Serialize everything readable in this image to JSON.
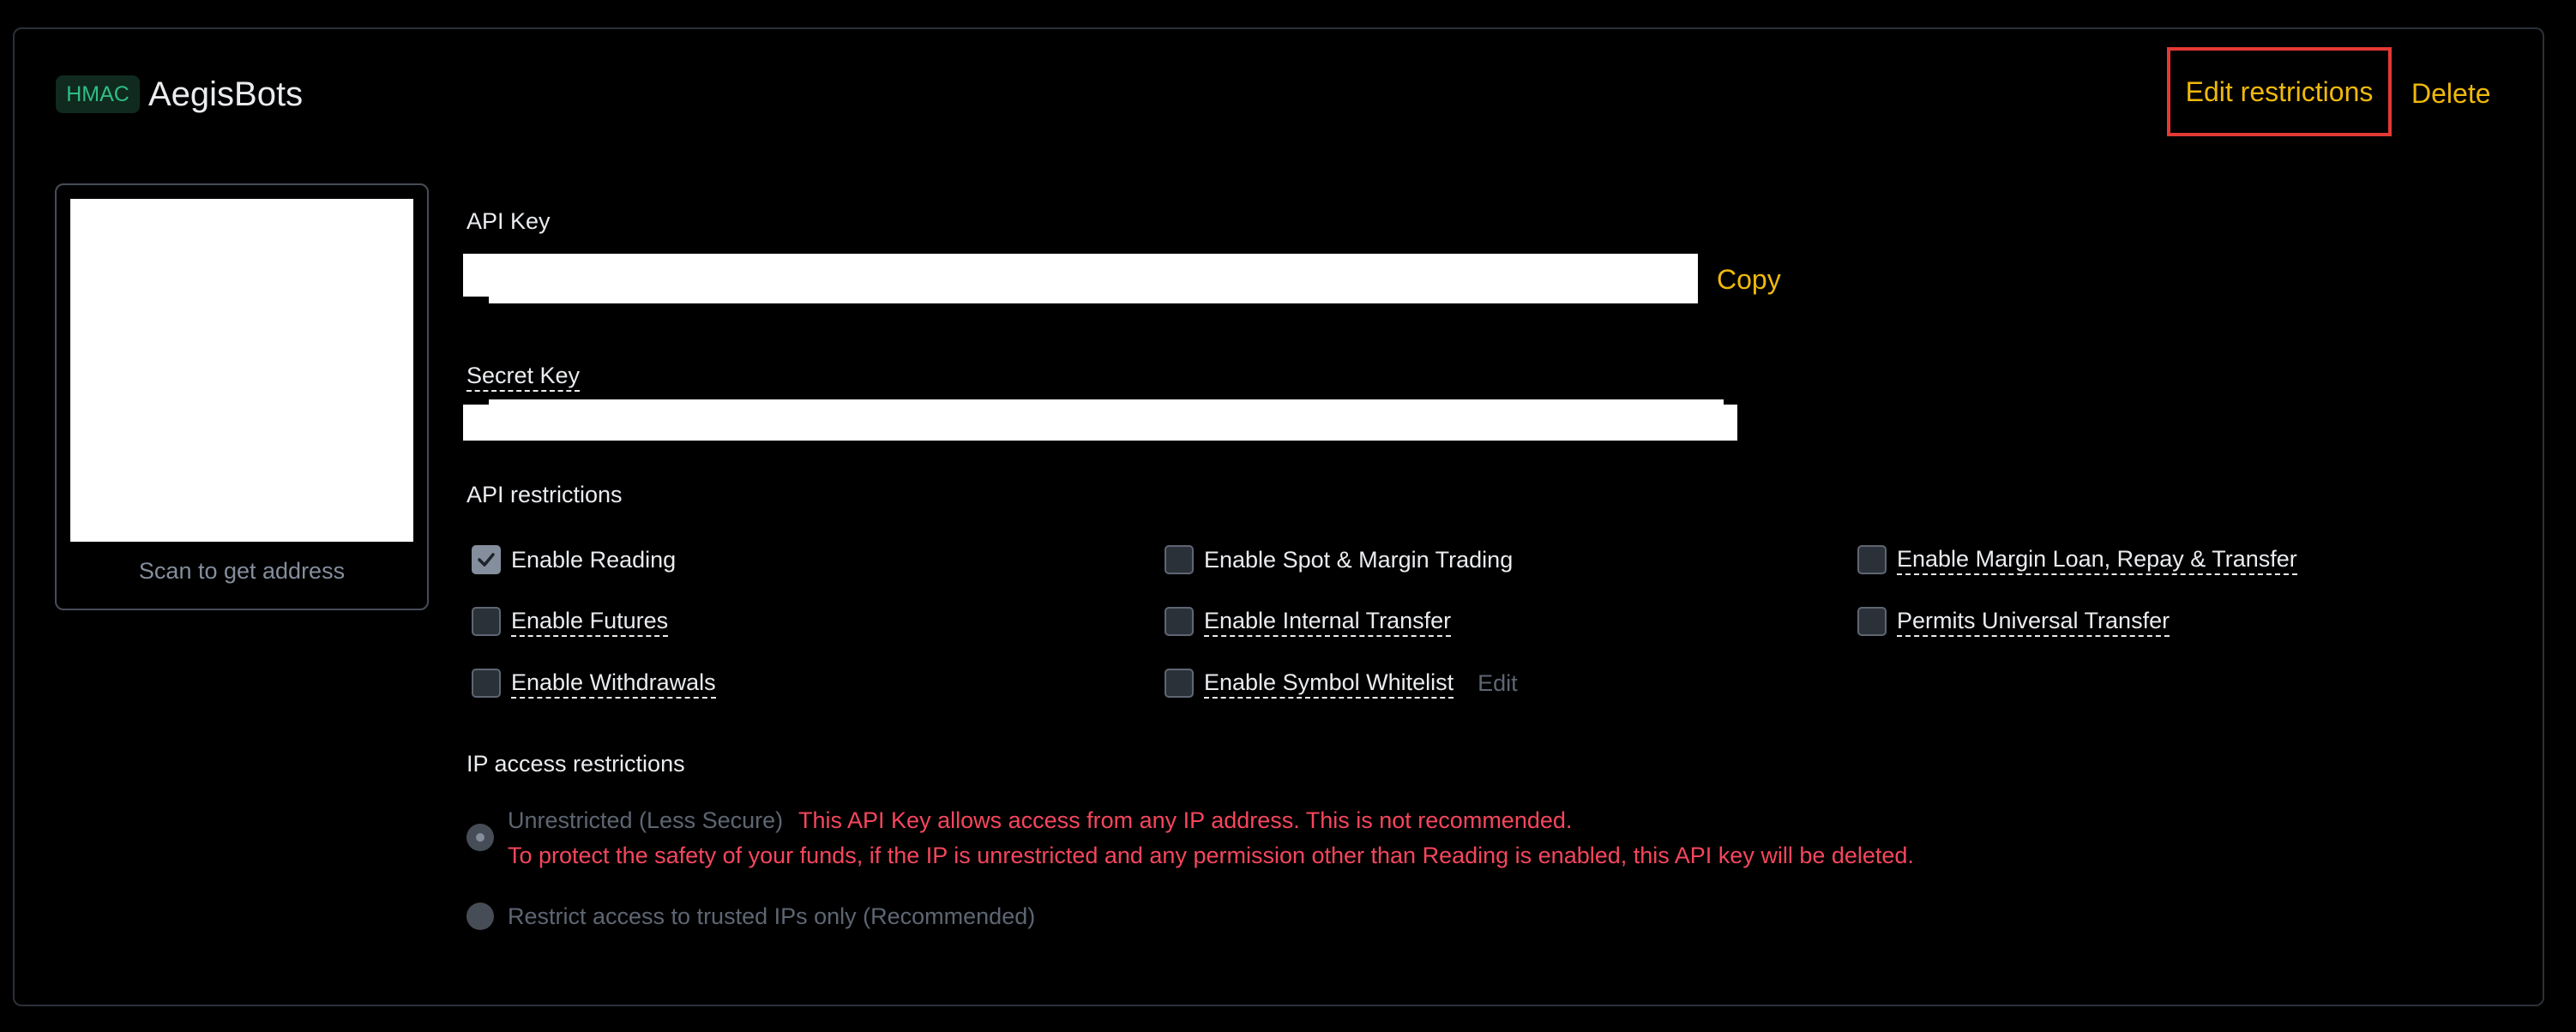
{
  "header": {
    "badge": "HMAC",
    "title": "AegisBots",
    "edit_restrictions_label": "Edit restrictions",
    "delete_label": "Delete"
  },
  "qr": {
    "caption": "Scan to get address"
  },
  "api_key": {
    "label": "API Key",
    "value": "",
    "copy_label": "Copy"
  },
  "secret_key": {
    "label": "Secret Key",
    "value": ""
  },
  "api_restrictions": {
    "heading": "API restrictions",
    "items": [
      {
        "label": "Enable Reading",
        "checked": true
      },
      {
        "label": "Enable Spot & Margin Trading",
        "checked": false
      },
      {
        "label": "Enable Margin Loan, Repay & Transfer",
        "checked": false
      },
      {
        "label": "Enable Futures",
        "checked": false
      },
      {
        "label": "Enable Internal Transfer",
        "checked": false
      },
      {
        "label": "Permits Universal Transfer",
        "checked": false
      },
      {
        "label": "Enable Withdrawals",
        "checked": false
      },
      {
        "label": "Enable Symbol Whitelist",
        "checked": false
      }
    ],
    "whitelist_edit_label": "Edit"
  },
  "ip_restrictions": {
    "heading": "IP access restrictions",
    "unrestricted_label": "Unrestricted (Less Secure)",
    "unrestricted_selected": true,
    "warning_line1": "This API Key allows access from any IP address. This is not recommended.",
    "warning_line2": "To protect the safety of your funds, if the IP is unrestricted and any permission other than Reading is enabled, this API key will be deleted.",
    "restricted_label": "Restrict access to trusted IPs only (Recommended)",
    "restricted_selected": false
  },
  "colors": {
    "background": "#000000",
    "accent": "#F0B90B",
    "warning": "#F6465D",
    "highlight_border": "#E53935",
    "badge_text": "#2EBD85"
  }
}
